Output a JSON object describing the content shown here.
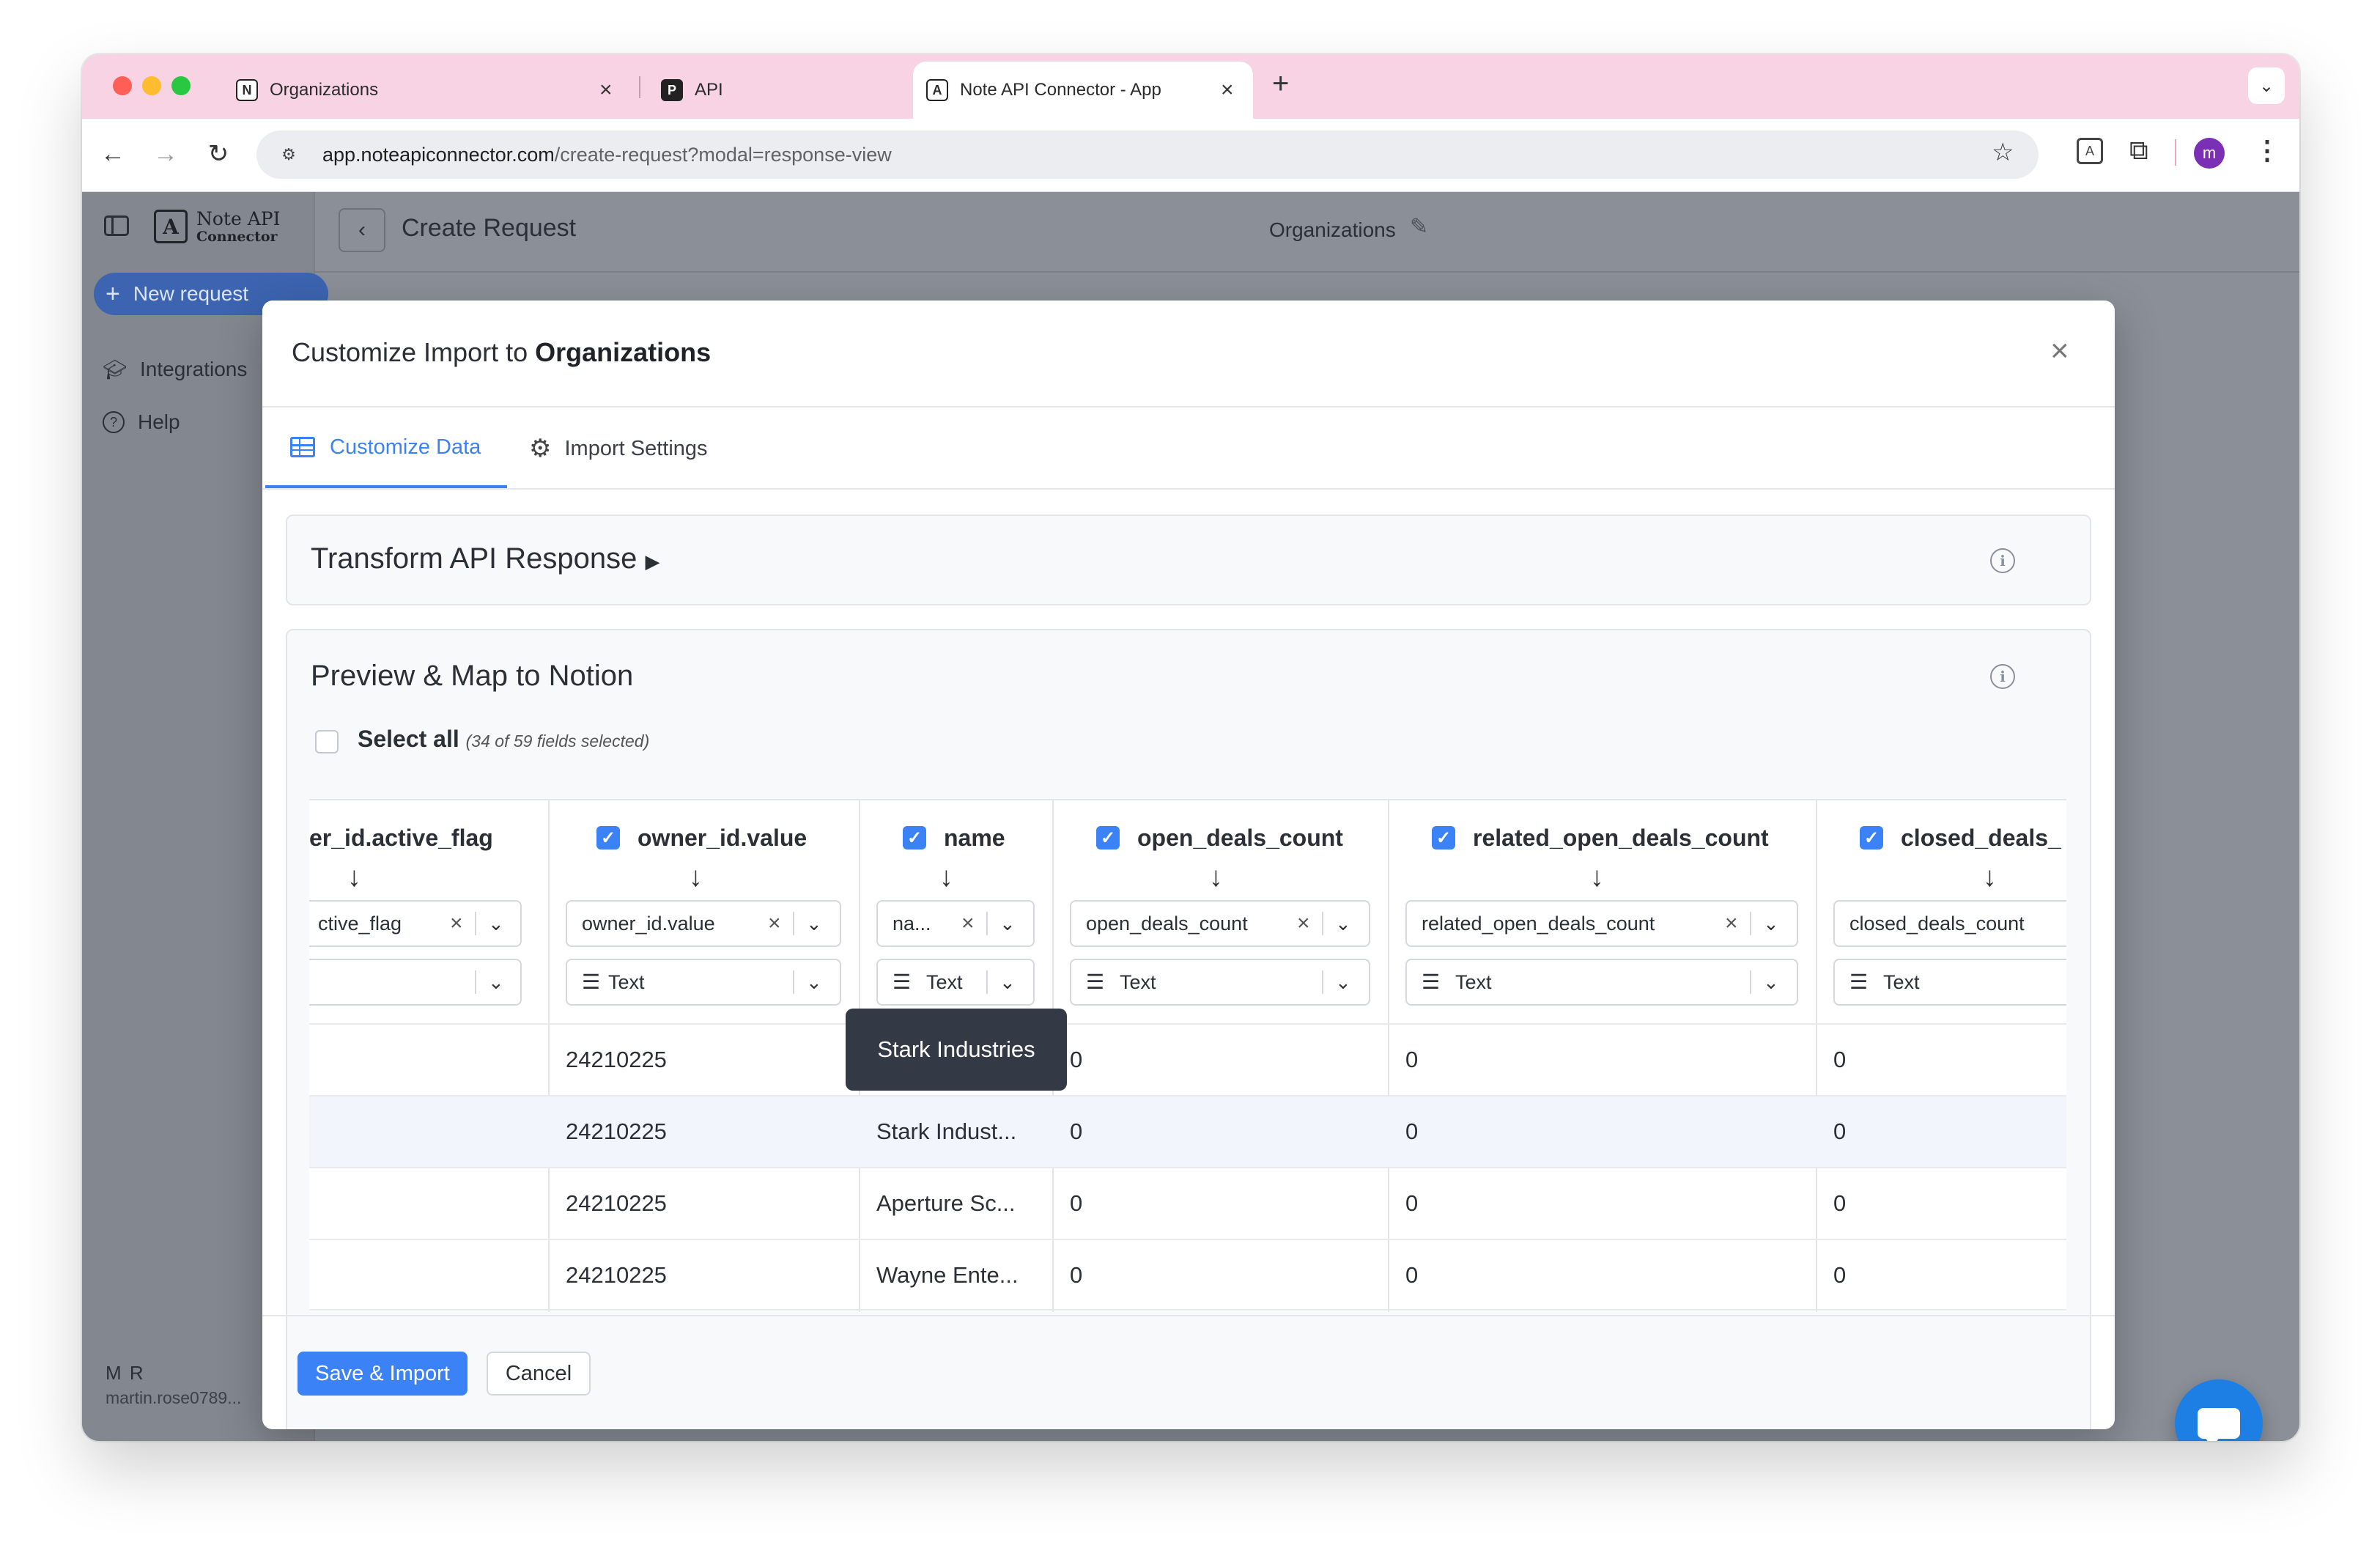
{
  "browser": {
    "tabs": [
      {
        "label": "Organizations",
        "icon": "N"
      },
      {
        "label": "API",
        "icon": "P"
      },
      {
        "label": "Note API Connector - App",
        "icon": "A"
      }
    ],
    "url_host": "app.noteapiconnector.com",
    "url_path": "/create-request?modal=response-view",
    "profile_initial": "m",
    "colors": {
      "tab_strip": "#f7d3e3",
      "profile": "#7b2fb5"
    }
  },
  "sidebar": {
    "logo_line1": "Note API",
    "logo_line2": "Connector",
    "new_request": "New request",
    "items": [
      {
        "label": "Integrations",
        "icon": "graduation-cap-icon"
      },
      {
        "label": "Help",
        "icon": "help-circle-icon"
      }
    ],
    "user_initials": "M R",
    "user_email": "martin.rose0789..."
  },
  "header": {
    "title": "Create Request",
    "target_db": "Organizations"
  },
  "modal": {
    "title_prefix": "Customize Import to",
    "title_target": "Organizations",
    "tabs": [
      {
        "label": "Customize Data",
        "active": true
      },
      {
        "label": "Import Settings",
        "active": false
      }
    ],
    "transform_title": "Transform API Response",
    "preview_title": "Preview & Map to Notion",
    "select_all_label": "Select all",
    "select_all_count": "(34 of 59 fields selected)",
    "columns": [
      {
        "header": "er_id.active_flag",
        "mapping": "ctive_flag",
        "type": ""
      },
      {
        "header": "owner_id.value",
        "mapping": "owner_id.value",
        "type": "Text"
      },
      {
        "header": "name",
        "mapping": "na...",
        "type": "Text"
      },
      {
        "header": "open_deals_count",
        "mapping": "open_deals_count",
        "type": "Text"
      },
      {
        "header": "related_open_deals_count",
        "mapping": "related_open_deals_count",
        "type": "Text"
      },
      {
        "header": "closed_deals_",
        "mapping": "closed_deals_count",
        "type": "Text"
      }
    ],
    "rows": [
      [
        "",
        "24210225",
        "Stark Industries",
        "0",
        "0",
        "0"
      ],
      [
        "",
        "24210225",
        "Stark Indust...",
        "0",
        "0",
        "0"
      ],
      [
        "",
        "24210225",
        "Aperture Sc...",
        "0",
        "0",
        "0"
      ],
      [
        "",
        "24210225",
        "Wayne Ente...",
        "0",
        "0",
        "0"
      ]
    ],
    "tooltip": "Stark Industries",
    "save_button": "Save & Import",
    "cancel_button": "Cancel",
    "colors": {
      "accent": "#3b82f6"
    }
  }
}
